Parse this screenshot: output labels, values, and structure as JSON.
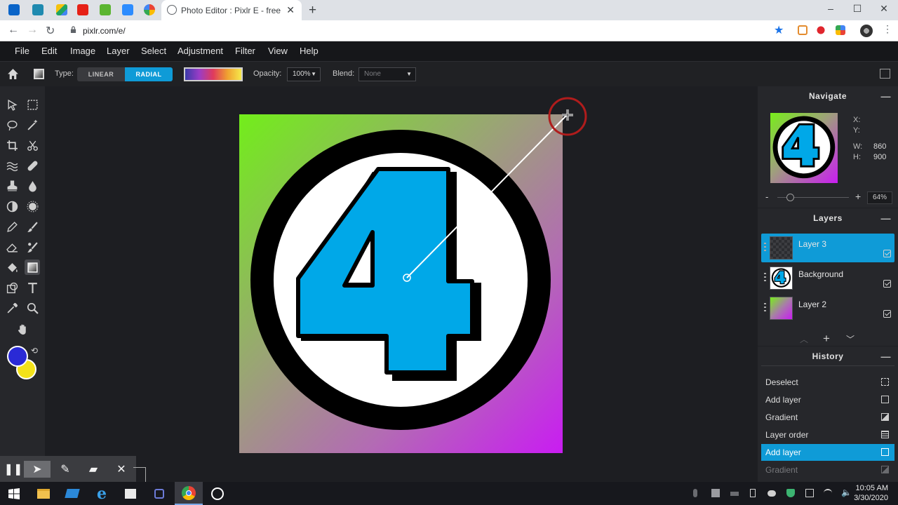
{
  "browser": {
    "tab_title": "Photo Editor : Pixlr E - free image",
    "new_tab": "+",
    "url": "pixlr.com/e/",
    "window_controls": {
      "minimize": "–",
      "maximize": "☐",
      "close": "✕"
    },
    "nav": {
      "back": "←",
      "forward": "→",
      "reload": "↻"
    }
  },
  "menu": [
    "File",
    "Edit",
    "Image",
    "Layer",
    "Select",
    "Adjustment",
    "Filter",
    "View",
    "Help"
  ],
  "options": {
    "type_label": "Type:",
    "type_options": [
      "LINEAR",
      "RADIAL"
    ],
    "type_selected": "RADIAL",
    "opacity_label": "Opacity:",
    "opacity_value": "100%",
    "blend_label": "Blend:",
    "blend_value": "None"
  },
  "navigate": {
    "title": "Navigate",
    "x_label": "X:",
    "y_label": "Y:",
    "w_label": "W:",
    "w_value": "860",
    "h_label": "H:",
    "h_value": "900",
    "zoom_minus": "-",
    "zoom_plus": "+",
    "zoom_value": "64%",
    "zoom_level": 0.18
  },
  "layers": {
    "title": "Layers",
    "items": [
      {
        "name": "Layer 3",
        "active": true,
        "visible": true
      },
      {
        "name": "Background",
        "active": false,
        "visible": true
      },
      {
        "name": "Layer 2",
        "active": false,
        "visible": true
      }
    ]
  },
  "history": {
    "title": "History",
    "items": [
      {
        "name": "Deselect",
        "state": "normal"
      },
      {
        "name": "Add layer",
        "state": "normal"
      },
      {
        "name": "Gradient",
        "state": "normal"
      },
      {
        "name": "Layer order",
        "state": "normal"
      },
      {
        "name": "Add layer",
        "state": "active"
      },
      {
        "name": "Gradient",
        "state": "dim"
      }
    ]
  },
  "canvas": {
    "badge_text": "4"
  },
  "colors": {
    "primary": "#2a2ad6",
    "secondary": "#f3e21a",
    "accent": "#0f9bd7",
    "logo_fill": "#00a8e8"
  },
  "taskbar": {
    "time": "10:05 AM",
    "date": "3/30/2020"
  }
}
